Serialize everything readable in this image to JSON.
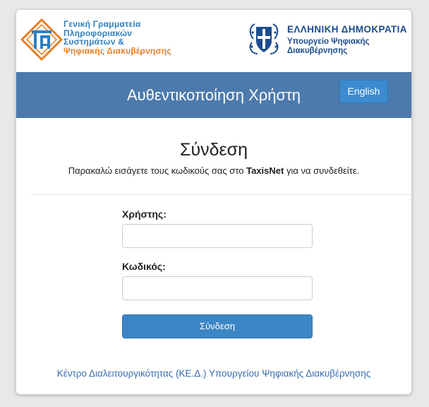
{
  "header": {
    "gsis_logo_lines": [
      "Γενική Γραμματεία",
      "Πληροφοριακών",
      "Συστημάτων &"
    ],
    "gsis_logo_line_orange": "Ψηφιακής Διακυβέρνησης",
    "gov_title": "ΕΛΛΗΝΙΚΗ ΔΗΜΟΚΡΑΤΙΑ",
    "gov_ministry_line1": "Υπουργείο Ψηφιακής",
    "gov_ministry_line2": "Διακυβέρνησης"
  },
  "title_bar": {
    "title": "Αυθεντικοποίηση Χρήστη",
    "language_button": "English"
  },
  "login": {
    "heading": "Σύνδεση",
    "instructions_before": "Παρακαλώ εισάγετε τους κωδικούς σας στο ",
    "instructions_bold": "TaxisNet",
    "instructions_after": " για να συνδεθείτε.",
    "username_label": "Χρήστης:",
    "username_value": "",
    "password_label": "Κωδικός:",
    "password_value": "",
    "submit_label": "Σύνδεση"
  },
  "footer": {
    "link_text": "Κέντρο Διαλειτουργικότητας (ΚΕ.Δ.) Υπουργείου Ψηφιακής Διακυβέρνησης"
  },
  "colors": {
    "title_bar": "#4d7aad",
    "accent_button": "#3d86c6",
    "gsis_blue": "#2e7fc1",
    "gsis_orange": "#e67e22",
    "gov_blue": "#1d4b8f",
    "link": "#3a6fb0"
  },
  "icons": {
    "gsis_logo": "gsis-logo-icon",
    "gov_emblem": "greek-coat-of-arms-icon"
  }
}
